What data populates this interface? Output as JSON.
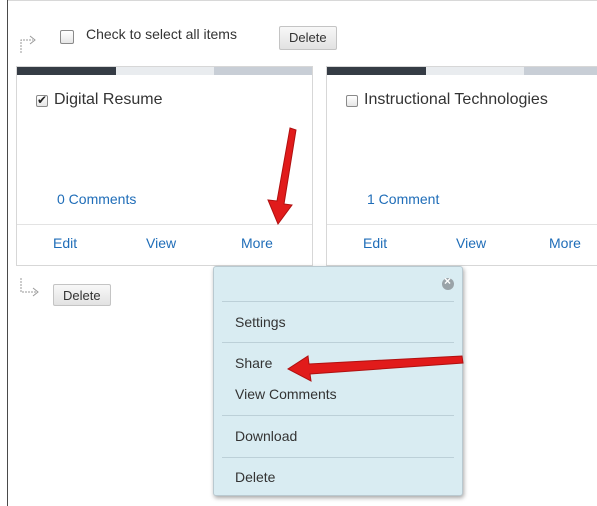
{
  "toolbar": {
    "select_all_label": "Check to select all items",
    "delete_top": "Delete",
    "delete_bottom": "Delete"
  },
  "cards": [
    {
      "title": "Digital Resume",
      "checked": true,
      "comments": "0 Comments",
      "actions": [
        "Edit",
        "View",
        "More"
      ]
    },
    {
      "title": "Instructional Technologies",
      "checked": false,
      "comments": "1 Comment",
      "actions": [
        "Edit",
        "View",
        "More"
      ]
    }
  ],
  "popup": {
    "items": [
      "Settings",
      "Share",
      "View Comments",
      "Download",
      "Delete"
    ]
  },
  "colors": {
    "link": "#1f6db8",
    "popup_bg": "#d9ecf2",
    "annotation_arrow": "#e11b1b",
    "bar_dark": "#353c45"
  }
}
